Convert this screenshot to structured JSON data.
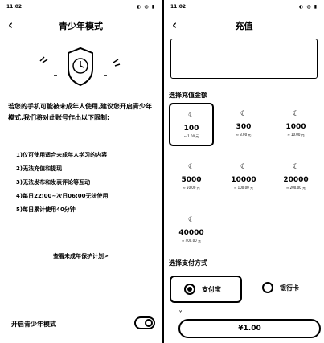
{
  "left": {
    "status": {
      "time": "11:02",
      "icons": "◐ ◍ ▮"
    },
    "nav": {
      "back": "‹",
      "title": "青少年模式"
    },
    "intro": "若您的手机可能被未成年人使用,建议您开启青少年模式,我们将对此账号作出以下限制:",
    "rules": [
      "1)仅可使用适合未成年人学习的内容",
      "2)无法充值和提现",
      "3)无法发布和发表评论等互动",
      "4)每日22:00~次日06:00无法使用",
      "5)每日累计使用40分钟"
    ],
    "policy_link": "查看未成年保护计划>",
    "toggle_label": "开启青少年模式",
    "toggle_on": true
  },
  "right": {
    "status": {
      "time": "11:02",
      "icons": "◐ ◍ ▮"
    },
    "nav": {
      "back": "‹",
      "title": "充值"
    },
    "amount_section": "选择充值金额",
    "amounts": [
      {
        "value": "100",
        "sub": "≈ 1.00 元",
        "selected": true
      },
      {
        "value": "300",
        "sub": "≈ 3.00 元",
        "selected": false
      },
      {
        "value": "1000",
        "sub": "≈ 10.00 元",
        "selected": false
      },
      {
        "value": "5000",
        "sub": "≈ 50.00 元",
        "selected": false
      },
      {
        "value": "10000",
        "sub": "≈ 100.00 元",
        "selected": false
      },
      {
        "value": "20000",
        "sub": "≈ 200.00 元",
        "selected": false
      },
      {
        "value": "40000",
        "sub": "≈ 400.00 元",
        "selected": false
      }
    ],
    "pay_section": "选择支付方式",
    "pay_methods": [
      {
        "label": "支付宝",
        "selected": true
      },
      {
        "label": "银行卡",
        "selected": false
      }
    ],
    "pay_note": "¥",
    "pay_button": "¥1.00"
  },
  "colors": {
    "fg": "#000000",
    "bg": "#ffffff"
  }
}
